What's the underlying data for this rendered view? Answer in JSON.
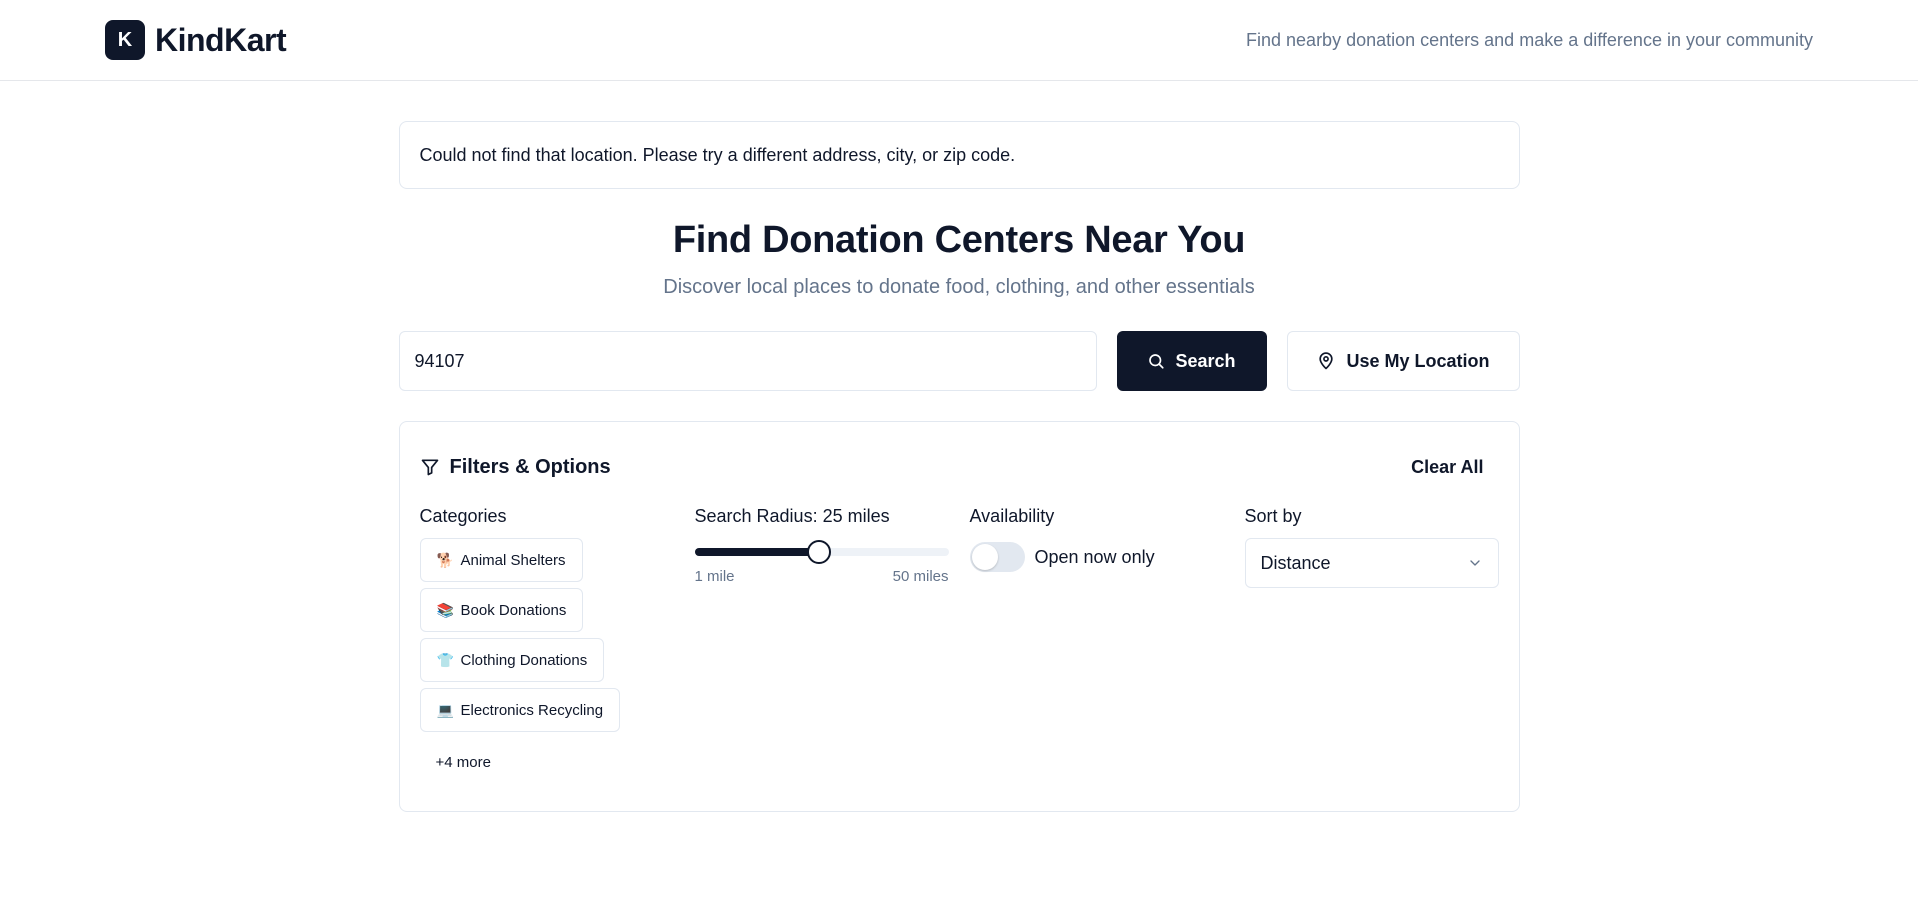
{
  "header": {
    "logo_letter": "K",
    "brand": "KindKart",
    "tagline": "Find nearby donation centers and make a difference in your community"
  },
  "alert": {
    "message": "Could not find that location. Please try a different address, city, or zip code."
  },
  "hero": {
    "title": "Find Donation Centers Near You",
    "subtitle": "Discover local places to donate food, clothing, and other essentials"
  },
  "search": {
    "value": "94107",
    "search_label": "Search",
    "location_label": "Use My Location"
  },
  "filters": {
    "title": "Filters & Options",
    "clear_label": "Clear All",
    "categories": {
      "label": "Categories",
      "items": [
        {
          "emoji": "🐕",
          "label": "Animal Shelters"
        },
        {
          "emoji": "📚",
          "label": "Book Donations"
        },
        {
          "emoji": "👕",
          "label": "Clothing Donations"
        },
        {
          "emoji": "💻",
          "label": "Electronics Recycling"
        }
      ],
      "more_label": "+4 more"
    },
    "radius": {
      "label": "Search Radius: 25 miles",
      "min": 1,
      "max": 50,
      "value": 25,
      "min_label": "1 mile",
      "max_label": "50 miles"
    },
    "availability": {
      "label": "Availability",
      "toggle_label": "Open now only",
      "enabled": false
    },
    "sort": {
      "label": "Sort by",
      "selected": "Distance"
    }
  }
}
